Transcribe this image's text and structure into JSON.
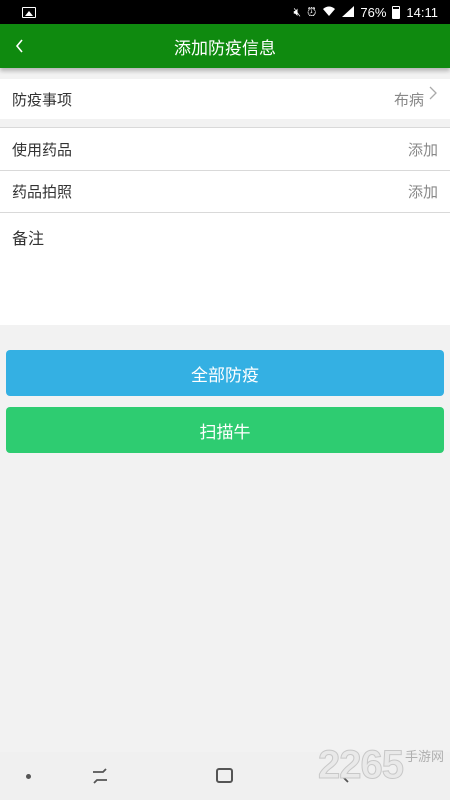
{
  "status_bar": {
    "battery": "76%",
    "time": "14:11",
    "icons": [
      "image-icon",
      "mute-icon",
      "alarm-icon",
      "wifi-icon",
      "signal-icon",
      "battery-icon"
    ]
  },
  "header": {
    "title": "添加防疫信息",
    "back_icon": "chevron-left-icon",
    "color": "#0f8a0f"
  },
  "form": {
    "item": {
      "label": "防疫事项",
      "value": "布病"
    },
    "medicine": {
      "label": "使用药品",
      "action": "添加"
    },
    "photo": {
      "label": "药品拍照",
      "action": "添加"
    },
    "notes": {
      "label": "备注"
    }
  },
  "buttons": {
    "all": {
      "label": "全部防疫",
      "color": "#34b0e3"
    },
    "scan": {
      "label": "扫描牛",
      "color": "#2ecc71"
    }
  },
  "watermark": {
    "number": "2265",
    "text": "手游网"
  }
}
